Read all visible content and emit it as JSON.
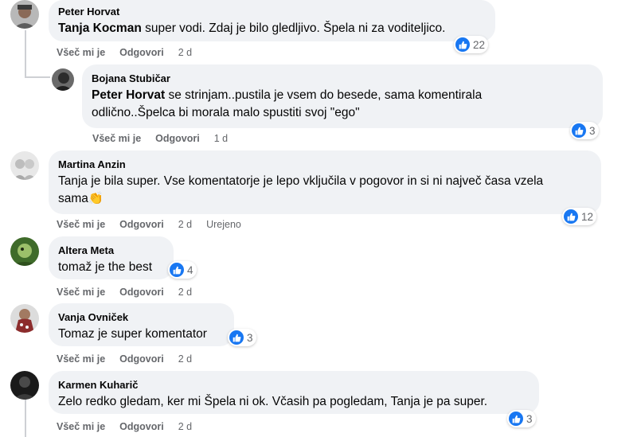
{
  "comments": [
    {
      "author": "Peter Horvat",
      "mention": "Tanja Kocman",
      "text": " super vodi. Zdaj je bilo gledljivo. Špela ni za voditeljico.",
      "reaction_count": "22",
      "like": "Všeč mi je",
      "reply": "Odgovori",
      "time": "2 d"
    },
    {
      "author": "Bojana Stubičar",
      "mention": "Peter Horvat",
      "text": " se strinjam..pustila je vsem do besede, sama komentirala odlično..Špelca bi morala malo spustiti svoj \"ego\"",
      "reaction_count": "3",
      "like": "Všeč mi je",
      "reply": "Odgovori",
      "time": "1 d"
    },
    {
      "author": "Martina Anzin",
      "text": "Tanja je bila super. Vse komentatorje je lepo vključila v pogovor in si ni največ časa vzela sama👏",
      "reaction_count": "12",
      "like": "Všeč mi je",
      "reply": "Odgovori",
      "time": "2 d",
      "edited": "Urejeno"
    },
    {
      "author": "Altera Meta",
      "text": "tomaž je the best",
      "reaction_count": "4",
      "like": "Všeč mi je",
      "reply": "Odgovori",
      "time": "2 d"
    },
    {
      "author": "Vanja Ovniček",
      "text": "Tomaz je super komentator",
      "reaction_count": "3",
      "like": "Všeč mi je",
      "reply": "Odgovori",
      "time": "2 d"
    },
    {
      "author": "Karmen Kuharič",
      "text": "Zelo redko gledam, ker mi Špela ni ok. Včasih pa pogledam, Tanja je pa super.",
      "reaction_count": "3",
      "like": "Všeč mi je",
      "reply": "Odgovori",
      "time": "2 d"
    }
  ],
  "colors": {
    "bubble": "#f0f2f5",
    "like_blue": "#1877f2",
    "meta_gray": "#65676b",
    "thread_line": "#ced0d4"
  },
  "icons": {
    "reaction": "like-thumbs-up-icon"
  }
}
